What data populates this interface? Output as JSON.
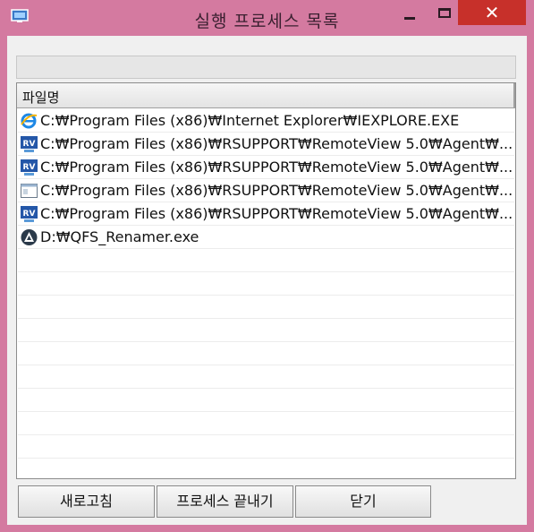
{
  "window": {
    "title": "실행 프로세스 목록",
    "close_glyph": "✕"
  },
  "status": {
    "text": ""
  },
  "list": {
    "column_header": "파일명",
    "rows": [
      {
        "icon": "internet-explorer-icon",
        "path": "C:₩Program Files (x86)₩Internet Explorer₩IEXPLORE.EXE"
      },
      {
        "icon": "remoteview-icon",
        "path": "C:₩Program Files (x86)₩RSUPPORT₩RemoteView 5.0₩Agent₩..."
      },
      {
        "icon": "remoteview-icon",
        "path": "C:₩Program Files (x86)₩RSUPPORT₩RemoteView 5.0₩Agent₩..."
      },
      {
        "icon": "application-window-icon",
        "path": "C:₩Program Files (x86)₩RSUPPORT₩RemoteView 5.0₩Agent₩..."
      },
      {
        "icon": "remoteview-icon",
        "path": "C:₩Program Files (x86)₩RSUPPORT₩RemoteView 5.0₩Agent₩..."
      },
      {
        "icon": "qfs-renamer-icon",
        "path": "D:₩QFS_Renamer.exe"
      }
    ]
  },
  "buttons": {
    "refresh": "새로고침",
    "kill_process": "프로세스 끝내기",
    "close": "닫기"
  },
  "colors": {
    "titlebar": "#d47aa0",
    "close_button": "#c7302a",
    "client_bg": "#f0f0f0"
  }
}
